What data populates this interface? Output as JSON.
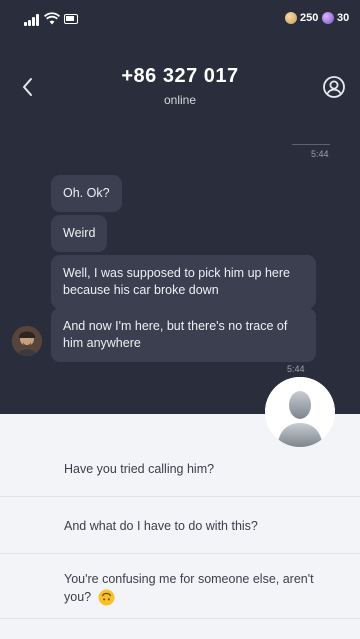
{
  "status_bar": {
    "coins": "250",
    "gems": "30"
  },
  "header": {
    "title": "+86 327 017",
    "subtitle": "online"
  },
  "messages": {
    "top_time": "5:44",
    "received": [
      "Oh. Ok?",
      "Weird",
      "Well, I was supposed to pick him up here because his car broke down",
      "And now I'm here, but there's no trace of him anywhere"
    ],
    "bottom_time": "5:44"
  },
  "reply_options": [
    "Have you tried calling him?",
    "And what do I have to do with this?",
    "You're confusing me for someone else, aren't you?"
  ],
  "icons": {
    "back": "chevron-left-icon",
    "profile": "user-circle-icon",
    "emoji": "upside-down-face-emoji"
  },
  "colors": {
    "background": "#2a2d3b",
    "bubble": "#3c3f4f",
    "panel": "#f3f4f7"
  }
}
